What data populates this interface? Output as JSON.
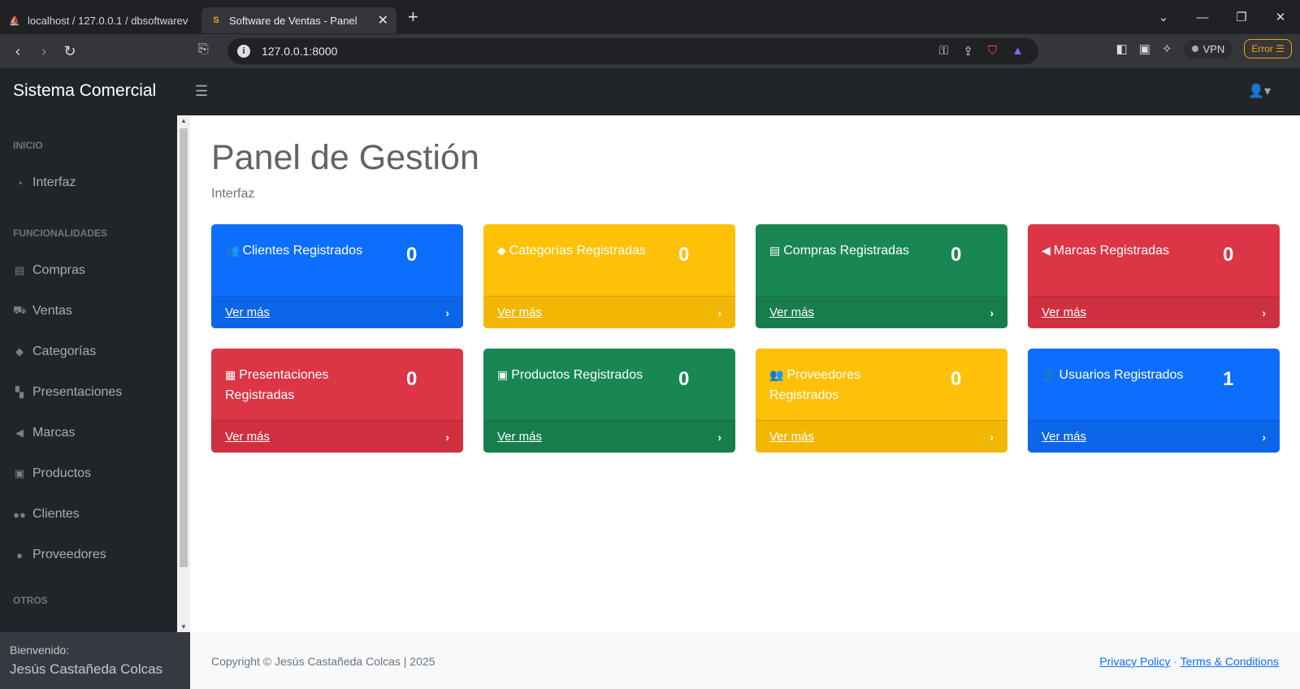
{
  "browser": {
    "tabs": [
      {
        "title": "localhost / 127.0.0.1 / dbsoftwareve",
        "active": false
      },
      {
        "title": "Software de Ventas - Panel",
        "active": true
      }
    ],
    "url": "127.0.0.1:8000",
    "vpn_label": "VPN",
    "error_label": "Error"
  },
  "app": {
    "brand": "Sistema Comercial"
  },
  "sidebar": {
    "headings": [
      "INICIO",
      "FUNCIONALIDADES",
      "OTROS"
    ],
    "items": [
      {
        "label": "Interfaz",
        "icon": "dashboard-icon"
      },
      {
        "label": "Compras",
        "icon": "store-icon"
      },
      {
        "label": "Ventas",
        "icon": "cart-icon"
      },
      {
        "label": "Categorías",
        "icon": "tag-icon"
      },
      {
        "label": "Presentaciones",
        "icon": "boxes-icon"
      },
      {
        "label": "Marcas",
        "icon": "bullhorn-icon"
      },
      {
        "label": "Productos",
        "icon": "shopping-bag-icon"
      },
      {
        "label": "Clientes",
        "icon": "users-icon"
      },
      {
        "label": "Proveedores",
        "icon": "user-group-icon"
      }
    ],
    "footer": {
      "greeting": "Bienvenido:",
      "user": "Jesús Castañeda Colcas"
    }
  },
  "main": {
    "title": "Panel de Gestión",
    "breadcrumb": "Interfaz",
    "more_label": "Ver más",
    "cards": [
      {
        "label": "Clientes Registrados",
        "count": "0",
        "color": "#0d6efd",
        "icon": "people-icon"
      },
      {
        "label": "Categorías Registradas",
        "count": "0",
        "color": "#ffc107",
        "icon": "tag-icon"
      },
      {
        "label": "Compras Registradas",
        "count": "0",
        "color": "#198754",
        "icon": "store-icon"
      },
      {
        "label": "Marcas Registradas",
        "count": "0",
        "color": "#dc3545",
        "icon": "bullhorn-icon"
      },
      {
        "label": "Presentaciones Registradas",
        "count": "0",
        "color": "#dc3545",
        "icon": "archive-icon"
      },
      {
        "label": "Productos Registrados",
        "count": "0",
        "color": "#198754",
        "icon": "shopping-bag-icon"
      },
      {
        "label": "Proveedores Registrados",
        "count": "0",
        "color": "#ffc107",
        "icon": "user-group-icon"
      },
      {
        "label": "Usuarios Registrados",
        "count": "1",
        "color": "#0d6efd",
        "icon": "user-icon"
      }
    ]
  },
  "footer": {
    "copyright": "Copyright © Jesús Castañeda Colcas | 2025",
    "privacy": "Privacy Policy",
    "separator": "·",
    "terms": "Terms & Conditions"
  }
}
